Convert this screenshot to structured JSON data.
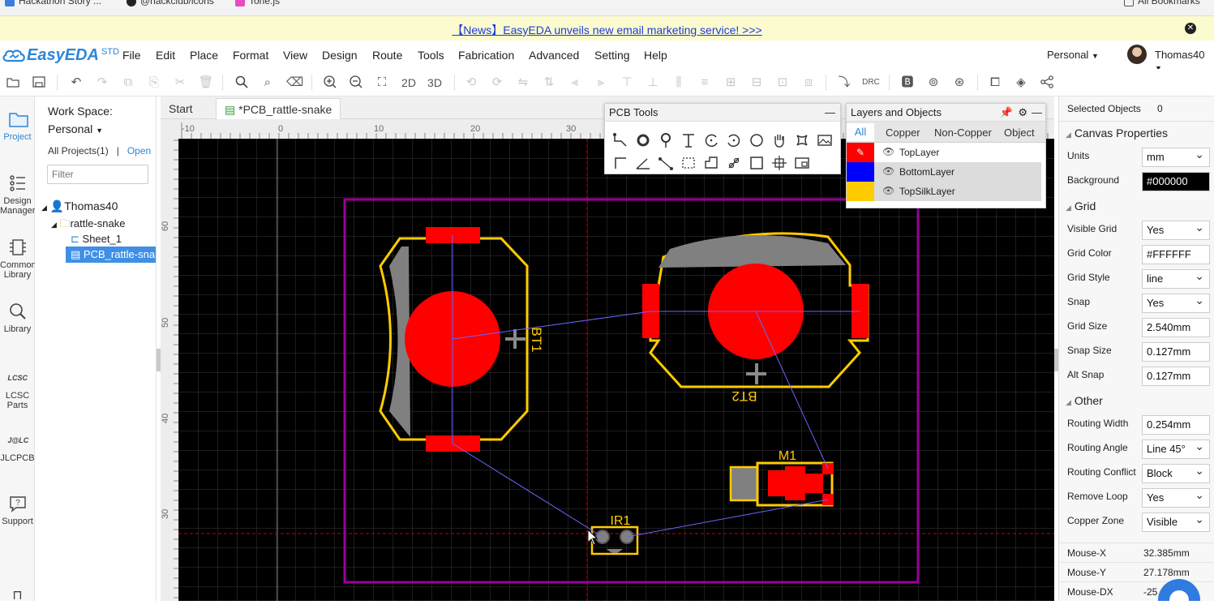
{
  "bookmarks": {
    "items": [
      "Hackathon Story ...",
      "@hackclub/icons",
      "Tone.js"
    ],
    "all_bookmarks": "All Bookmarks"
  },
  "news": {
    "text": "【News】EasyEDA unveils new email marketing service! >>>"
  },
  "app": {
    "logo": "EasyEDA",
    "edition": "STD"
  },
  "menu": [
    "File",
    "Edit",
    "Place",
    "Format",
    "View",
    "Design",
    "Route",
    "Tools",
    "Fabrication",
    "Advanced",
    "Setting",
    "Help"
  ],
  "account": {
    "workspace": "Personal",
    "user": "Thomas40"
  },
  "toolbar": {
    "view_2d": "2D",
    "view_3d": "3D",
    "drc": "DRC"
  },
  "leftnav": [
    {
      "label": "Project",
      "icon": "project-icon"
    },
    {
      "label": "Design Manager",
      "icon": "design-manager-icon"
    },
    {
      "label": "Common Library",
      "icon": "common-library-icon"
    },
    {
      "label": "Library",
      "icon": "library-search-icon"
    },
    {
      "label": "LCSC Parts",
      "icon": "lcsc-icon"
    },
    {
      "label": "JLCPCB",
      "icon": "jlcpcb-icon"
    },
    {
      "label": "Support",
      "icon": "support-icon"
    }
  ],
  "project_panel": {
    "workspace_label": "Work Space:",
    "workspace_value": "Personal",
    "all_projects": "All Projects(1)",
    "open": "Open",
    "filter_placeholder": "Filter",
    "tree": {
      "user": "Thomas40",
      "project": "rattle-snake",
      "sheet": "Sheet_1",
      "pcb": "PCB_rattle-snake"
    }
  },
  "tabs": {
    "start": "Start",
    "pcb": "*PCB_rattle-snake"
  },
  "ruler": {
    "top": [
      "-10",
      "0",
      "10",
      "20",
      "30"
    ],
    "left": [
      "60",
      "50",
      "40",
      "30"
    ]
  },
  "pcb": {
    "labels": {
      "bt1": "BT1",
      "bt2": "BT2",
      "m1": "M1",
      "ir1": "IR1"
    },
    "colors": {
      "top": "#ff0000",
      "silk": "#ffcc00",
      "outline": "#990099",
      "ratline": "#6666ff",
      "grid": "#3a3a3a"
    }
  },
  "pcb_tools": {
    "title": "PCB Tools"
  },
  "layers": {
    "title": "Layers and Objects",
    "tabs": [
      "All",
      "Copper",
      "Non-Copper",
      "Object"
    ],
    "items": [
      {
        "name": "TopLayer",
        "color": "#ff0000"
      },
      {
        "name": "BottomLayer",
        "color": "#0000ff"
      },
      {
        "name": "TopSilkLayer",
        "color": "#ffcc00"
      }
    ]
  },
  "properties": {
    "selected_label": "Selected Objects",
    "selected_count": "0",
    "canvas_title": "Canvas Properties",
    "units_label": "Units",
    "units": "mm",
    "background_label": "Background",
    "background": "#000000",
    "grid_title": "Grid",
    "visible_grid_label": "Visible Grid",
    "visible_grid": "Yes",
    "grid_color_label": "Grid Color",
    "grid_color": "#FFFFFF",
    "grid_style_label": "Grid Style",
    "grid_style": "line",
    "snap_label": "Snap",
    "snap": "Yes",
    "grid_size_label": "Grid Size",
    "grid_size": "2.540mm",
    "snap_size_label": "Snap Size",
    "snap_size": "0.127mm",
    "alt_snap_label": "Alt Snap",
    "alt_snap": "0.127mm",
    "other_title": "Other",
    "routing_width_label": "Routing Width",
    "routing_width": "0.254mm",
    "routing_angle_label": "Routing Angle",
    "routing_angle": "Line 45°",
    "routing_conflict_label": "Routing Conflict",
    "routing_conflict": "Block",
    "remove_loop_label": "Remove Loop",
    "remove_loop": "Yes",
    "copper_zone_label": "Copper Zone",
    "copper_zone": "Visible",
    "mouse_x_label": "Mouse-X",
    "mouse_x": "32.385mm",
    "mouse_y_label": "Mouse-Y",
    "mouse_y": "27.178mm",
    "mouse_dx_label": "Mouse-DX",
    "mouse_dx": "-25"
  }
}
